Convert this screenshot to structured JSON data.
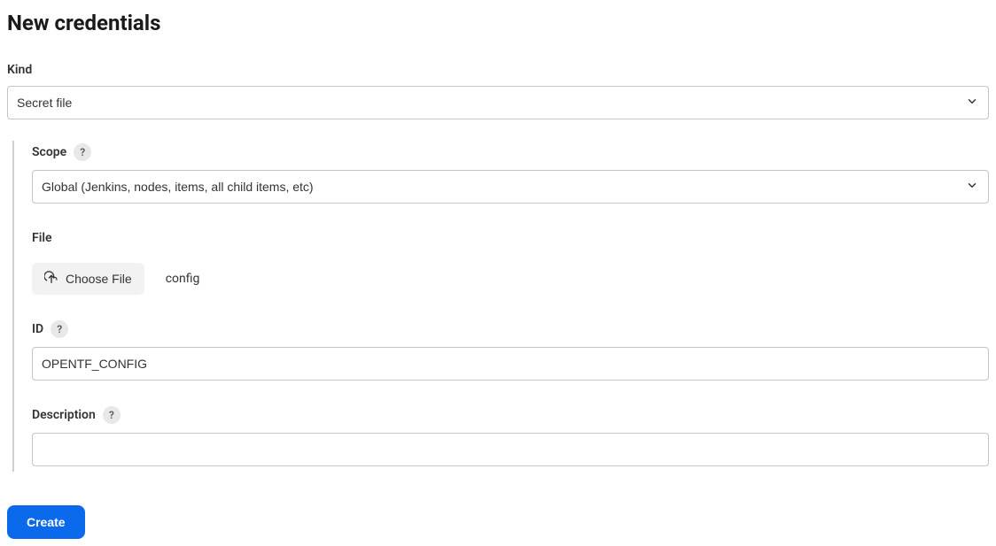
{
  "page": {
    "title": "New credentials"
  },
  "form": {
    "kind": {
      "label": "Kind",
      "value": "Secret file"
    },
    "scope": {
      "label": "Scope",
      "value": "Global (Jenkins, nodes, items, all child items, etc)"
    },
    "file": {
      "label": "File",
      "button_label": "Choose File",
      "selected_name": "config"
    },
    "id": {
      "label": "ID",
      "value": "OPENTF_CONFIG"
    },
    "description": {
      "label": "Description",
      "value": ""
    },
    "create_label": "Create",
    "help_glyph": "?"
  }
}
